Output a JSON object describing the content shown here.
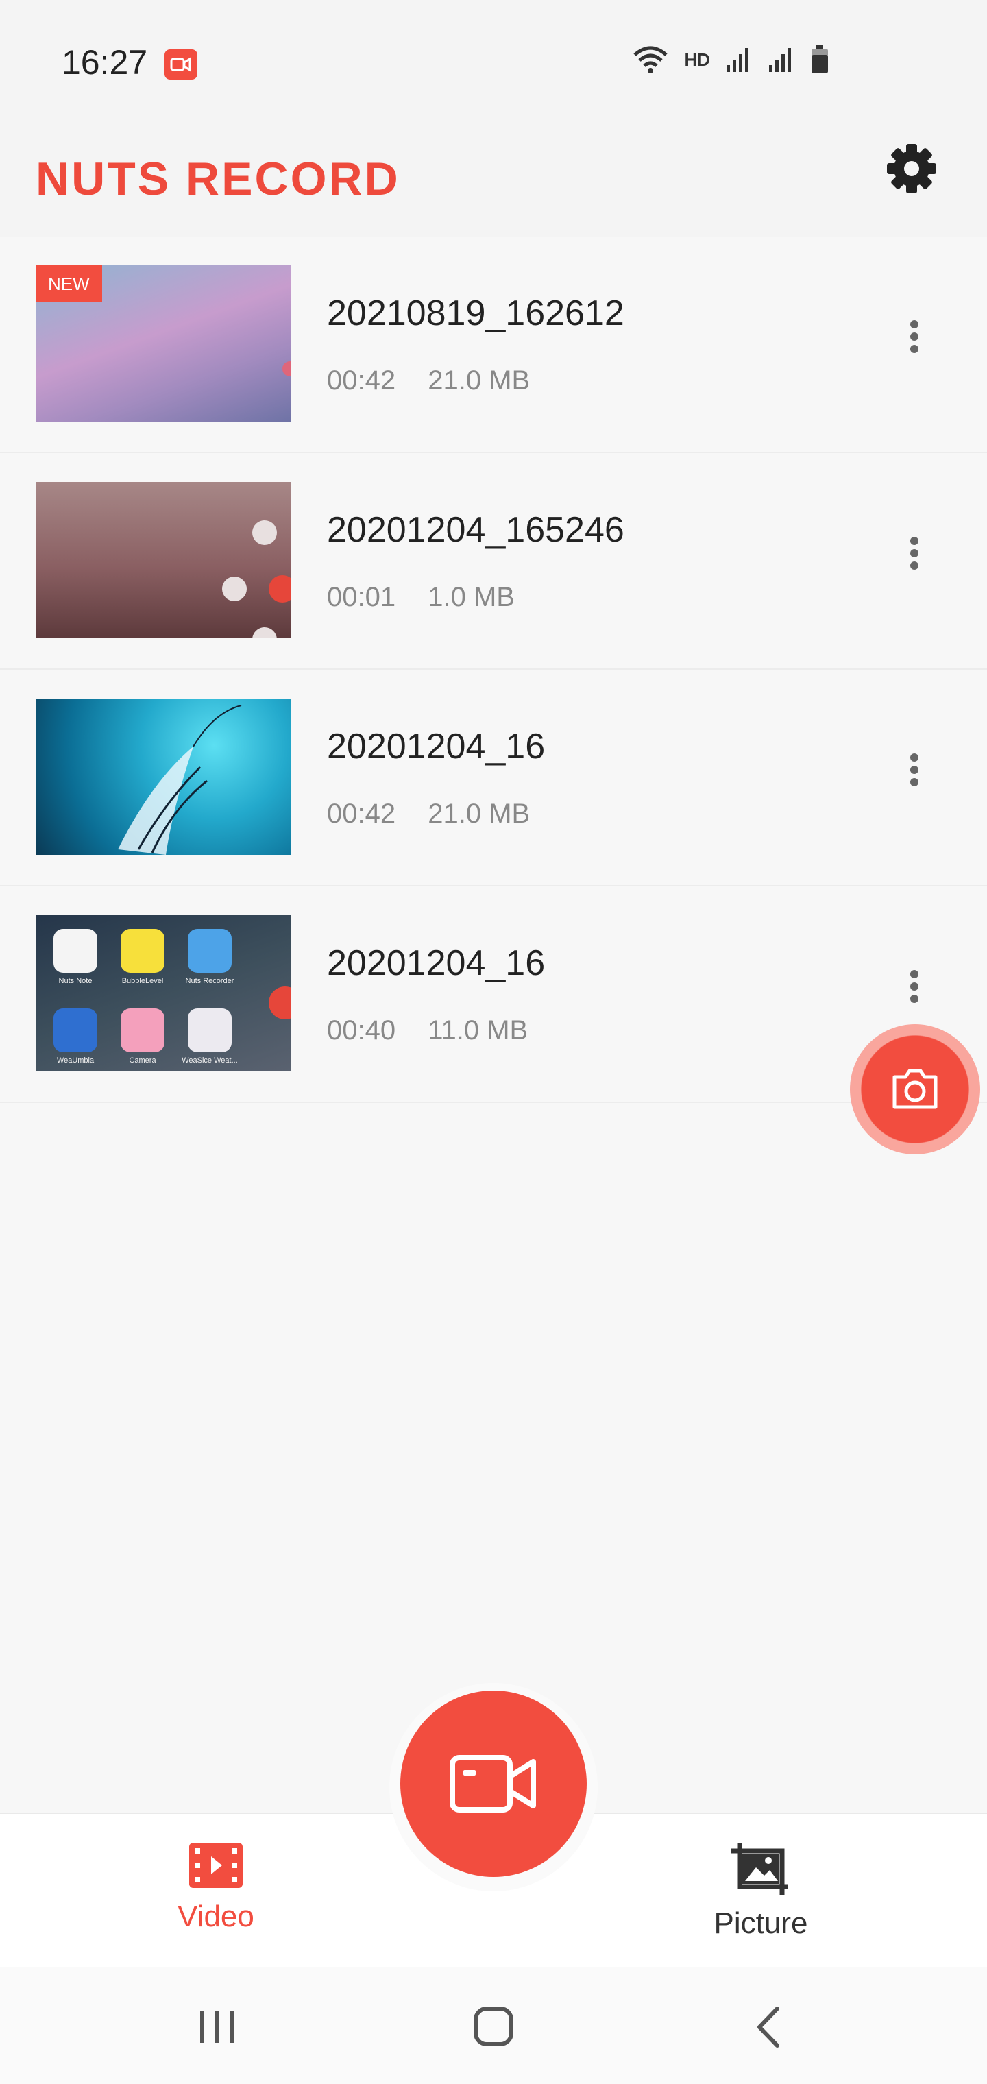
{
  "status_bar": {
    "time": "16:27",
    "hd": "HD"
  },
  "header": {
    "logo": "NUTS RECORD"
  },
  "videos": [
    {
      "badge": "NEW",
      "title": "20210819_162612",
      "duration": "00:42",
      "size": "21.0 MB"
    },
    {
      "title": "20201204_165246",
      "duration": "00:01",
      "size": "1.0 MB"
    },
    {
      "title": "20201204_16",
      "duration": "00:42",
      "size": "21.0 MB"
    },
    {
      "title": "20201204_16",
      "duration": "00:40",
      "size": "11.0 MB"
    }
  ],
  "thumb4_apps": [
    "Nuts Note",
    "BubbleLevel",
    "Nuts Recorder",
    "WeaUmbla",
    "Camera",
    "WeaSice Weat..."
  ],
  "bottom_nav": {
    "video_label": "Video",
    "picture_label": "Picture"
  },
  "colors": {
    "accent": "#f24d3f",
    "text": "#222222",
    "meta": "#888888"
  }
}
